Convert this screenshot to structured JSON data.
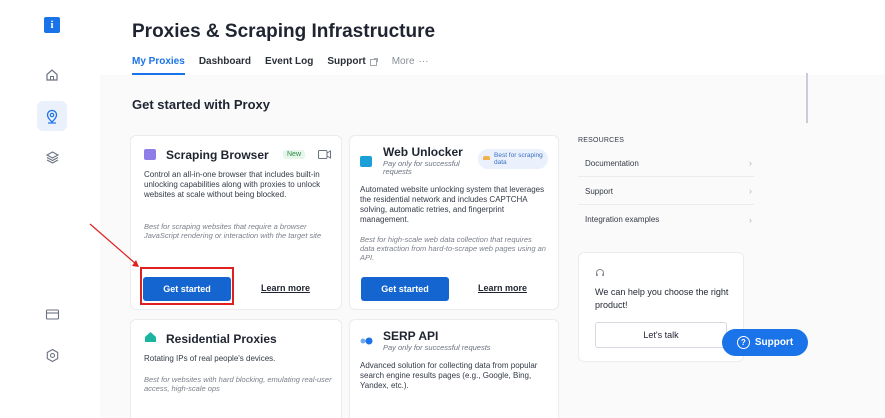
{
  "sidebar": {
    "logo": "i",
    "items": [
      {
        "name": "home",
        "icon": "home-icon"
      },
      {
        "name": "proxies",
        "icon": "location-pin-icon",
        "active": true
      },
      {
        "name": "layers",
        "icon": "layers-icon"
      },
      {
        "name": "billing",
        "icon": "card-icon"
      },
      {
        "name": "settings",
        "icon": "gear-icon"
      }
    ]
  },
  "header": {
    "title": "Proxies & Scraping Infrastructure",
    "tabs": [
      {
        "label": "My Proxies",
        "active": true
      },
      {
        "label": "Dashboard"
      },
      {
        "label": "Event Log"
      },
      {
        "label": "Support"
      },
      {
        "label": "More"
      }
    ]
  },
  "section": {
    "title": "Get started with Proxy"
  },
  "cards": {
    "scraping_browser": {
      "title": "Scraping Browser",
      "badge": "New",
      "desc": "Control an all-in-one browser that includes built-in unlocking capabilities along with proxies to unlock websites at scale without being blocked.",
      "best_for": "Best for scraping websites that require a browser JavaScript rendering or interaction with the target site",
      "primary": "Get started",
      "secondary": "Learn more"
    },
    "web_unlocker": {
      "title": "Web Unlocker",
      "subtitle": "Pay only for successful requests",
      "badge": "Best for scraping data",
      "desc": "Automated website unlocking system that leverages the residential network and includes CAPTCHA solving, automatic retries, and fingerprint management.",
      "best_for": "Best for high-scale web data collection that requires data extraction from hard-to-scrape web pages using an API.",
      "primary": "Get started",
      "secondary": "Learn more"
    },
    "residential": {
      "title": "Residential Proxies",
      "desc": "Rotating IPs of real people's devices.",
      "best_for": "Best for websites with hard blocking, emulating real-user access, high-scale ops"
    },
    "serp": {
      "title": "SERP API",
      "subtitle": "Pay only for successful requests",
      "desc": "Advanced solution for collecting data from popular search engine results pages (e.g., Google, Bing, Yandex, etc.)."
    }
  },
  "resources": {
    "heading": "RESOURCES",
    "items": [
      "Documentation",
      "Support",
      "Integration examples"
    ]
  },
  "help": {
    "text": "We can help you choose the right product!",
    "button": "Let's talk"
  },
  "support_button": {
    "label": "Support"
  },
  "colors": {
    "accent": "#1a73e8",
    "primary_button": "#1465d0",
    "annotation": "#e02020"
  }
}
